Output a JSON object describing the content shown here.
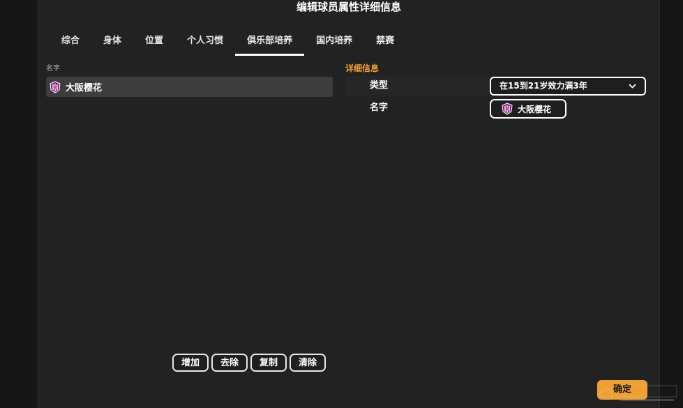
{
  "dialog": {
    "title": "编辑球员属性详细信息"
  },
  "tabs": [
    {
      "label": "综合"
    },
    {
      "label": "身体"
    },
    {
      "label": "位置"
    },
    {
      "label": "个人习惯"
    },
    {
      "label": "俱乐部培养",
      "active": true
    },
    {
      "label": "国内培养"
    },
    {
      "label": "禁赛"
    }
  ],
  "list": {
    "header": "名字",
    "items": [
      {
        "label": "大阪樱花",
        "icon": "club-crest-icon"
      }
    ]
  },
  "actions": {
    "add": "增加",
    "remove": "去除",
    "copy": "复制",
    "clear": "清除"
  },
  "details": {
    "title": "详细信息",
    "type_label": "类型",
    "type_value": "在15到21岁效力满3年",
    "name_label": "名字",
    "name_value": "大阪樱花"
  },
  "footer": {
    "confirm": "确定"
  },
  "colors": {
    "accent": "#f0a030",
    "background": "#222222",
    "selected_row": "#3d3d3d"
  }
}
